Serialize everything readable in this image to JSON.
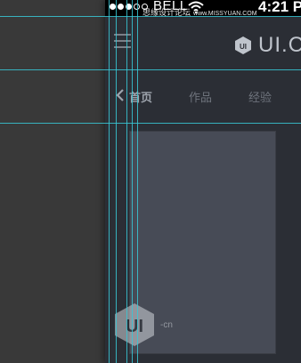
{
  "status_bar": {
    "carrier": "BELL",
    "time": "4:21 P",
    "signal_dots": [
      true,
      true,
      true,
      false,
      false
    ],
    "icons": [
      "signal-dots",
      "wifi-icon"
    ]
  },
  "watermark": {
    "cn": "思缘设计论坛",
    "en": "www.MISSYUAN.COM"
  },
  "header": {
    "menu_icon": "hamburger-menu-icon",
    "logo_mark_text": "UI",
    "logo_text": "UI.C"
  },
  "tabs": {
    "items": [
      {
        "label": "首页",
        "active": true
      },
      {
        "label": "作品",
        "active": false
      },
      {
        "label": "经验",
        "active": false
      }
    ],
    "back_icon": "chevron-left-icon"
  },
  "card": {
    "watermark_logo_mark": "UI",
    "watermark_logo_text": "-cn"
  },
  "colors": {
    "pasteboard": "#393939",
    "app_background": "#2b2e35",
    "card": "#474b56",
    "guide": "#38c8d6",
    "tab_active": "#9ea4ad",
    "tab_inactive": "#6e737c",
    "logo": "#bfc4cc"
  }
}
